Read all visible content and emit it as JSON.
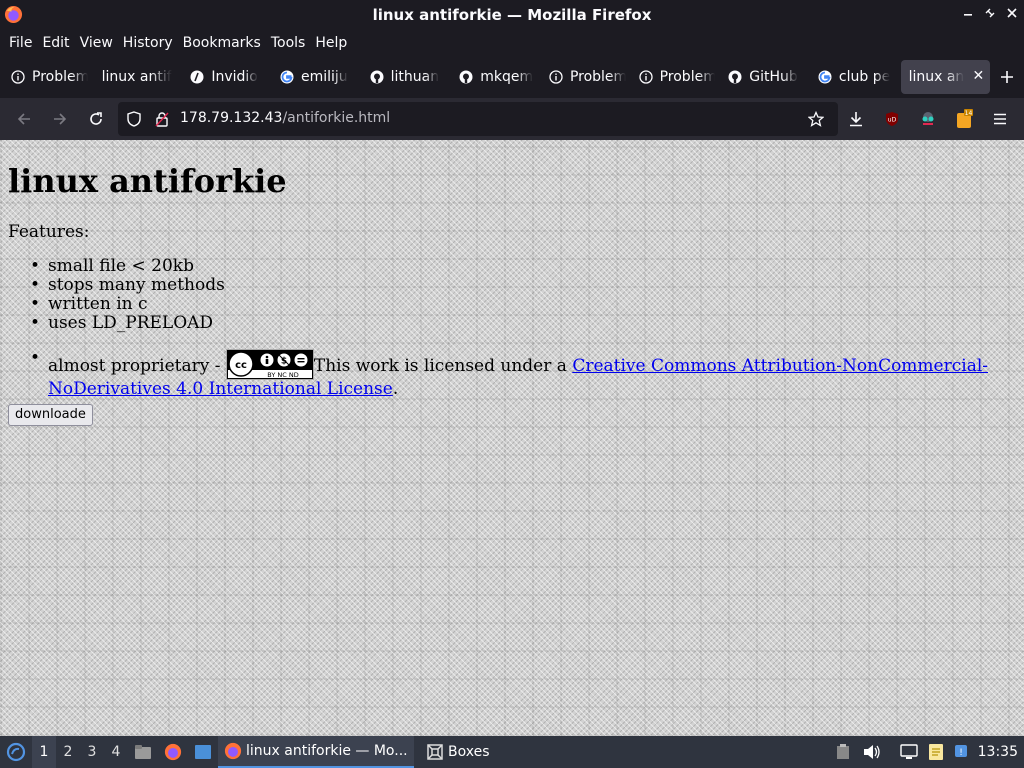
{
  "window": {
    "title": "linux antiforkie — Mozilla Firefox",
    "controls": [
      "minimize",
      "maximize",
      "close"
    ]
  },
  "menu": [
    "File",
    "Edit",
    "View",
    "History",
    "Bookmarks",
    "Tools",
    "Help"
  ],
  "tabs": [
    {
      "label": "Problem",
      "icon": "info-icon"
    },
    {
      "label": "linux antif",
      "icon": "none"
    },
    {
      "label": "Invidio",
      "icon": "invidious-icon"
    },
    {
      "label": "emiliju",
      "icon": "google-icon"
    },
    {
      "label": "lithuan",
      "icon": "github-icon"
    },
    {
      "label": "mkqem",
      "icon": "github-icon"
    },
    {
      "label": "Problem",
      "icon": "info-icon"
    },
    {
      "label": "Problem",
      "icon": "info-icon"
    },
    {
      "label": "GitHub",
      "icon": "github-icon"
    },
    {
      "label": "club pe",
      "icon": "google-icon"
    },
    {
      "label": "linux an",
      "icon": "none",
      "active": true
    }
  ],
  "nav": {
    "url_host": "178.79.132.43",
    "url_path": "/antiforkie.html",
    "extension_badge": "14"
  },
  "page": {
    "heading": "linux antiforkie",
    "features_label": "Features:",
    "features": [
      "small file < 20kb",
      "stops many methods",
      "written in c",
      "uses LD_PRELOAD"
    ],
    "license_prefix": "almost proprietary - ",
    "license_text": "This work is licensed under a ",
    "license_link": "Creative Commons Attribution-NonCommercial-NoDerivatives 4.0 International License",
    "license_suffix": ".",
    "cc_badge_text": "BY NC ND",
    "download_button": "downloade"
  },
  "taskbar": {
    "workspaces": [
      "1",
      "2",
      "3",
      "4"
    ],
    "tasks": [
      {
        "label": "linux antiforkie — Mo...",
        "icon": "firefox-icon",
        "active": true
      },
      {
        "label": "Boxes",
        "icon": "boxes-icon",
        "active": false
      }
    ],
    "clock": "13:35"
  }
}
